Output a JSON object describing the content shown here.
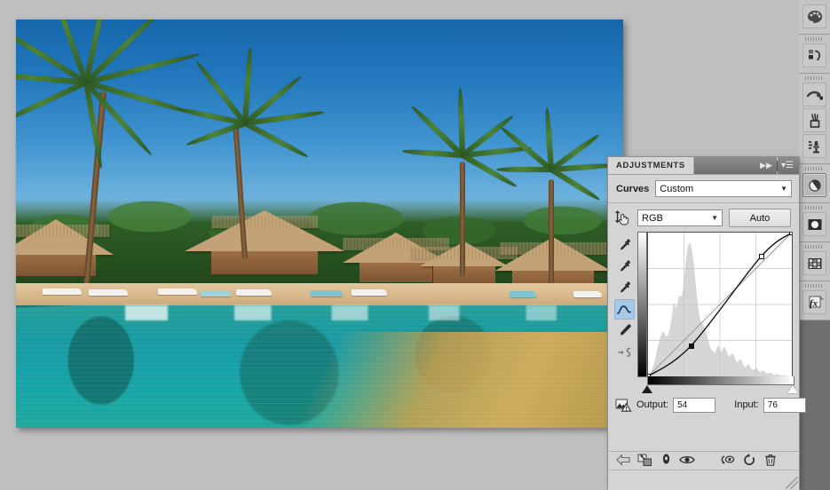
{
  "app": {
    "background_color": "#bfbfbf",
    "dock_background": "#6f6f6f"
  },
  "document": {
    "title": "tropical-resort-pool",
    "scene_description": "Tropical resort with palm trees, thatched palapa huts and a turquoise swimming pool with reflections",
    "sky_color": "#2277bd",
    "water_color": "#19a0a6",
    "sand_color": "#d6a046"
  },
  "panel": {
    "tab_label": "ADJUSTMENTS",
    "collapse_icon": "double-chevron-right-icon",
    "menu_icon": "panel-menu-icon",
    "preset": {
      "label": "Curves",
      "value": "Custom",
      "caret": "chevron-down-icon"
    },
    "channel": {
      "target_tool_icon": "on-image-adjust-icon",
      "value": "RGB",
      "caret": "chevron-down-icon",
      "auto_label": "Auto"
    },
    "curve_tools": [
      {
        "name": "black-point-eyedropper",
        "icon": "eyedropper-icon",
        "active": false
      },
      {
        "name": "gray-point-eyedropper",
        "icon": "eyedropper-icon",
        "active": false
      },
      {
        "name": "white-point-eyedropper",
        "icon": "eyedropper-icon",
        "active": false
      },
      {
        "name": "edit-points-tool",
        "icon": "curve-icon",
        "active": true
      },
      {
        "name": "pencil-draw-tool",
        "icon": "pencil-icon",
        "active": false
      },
      {
        "name": "smooth-curve-tool",
        "icon": "smooth-icon",
        "active": false
      }
    ],
    "io": {
      "clip_warning_icon": "clipping-warning-icon",
      "output_label": "Output:",
      "output_value": "54",
      "input_label": "Input:",
      "input_value": "76"
    },
    "footer_buttons": [
      {
        "name": "return-to-adjustment-list-button",
        "icon": "left-arrow-icon"
      },
      {
        "name": "clip-to-layer-button",
        "icon": "clip-to-layer-icon"
      },
      {
        "name": "toggle-layer-visibility-button",
        "icon": "eye-mask-icon"
      },
      {
        "name": "preview-button",
        "icon": "eye-icon"
      },
      {
        "name": "reset-previous-state-button",
        "icon": "undo-state-icon"
      },
      {
        "name": "reset-adjustment-button",
        "icon": "reset-icon"
      },
      {
        "name": "delete-adjustment-layer-button",
        "icon": "trash-icon"
      }
    ]
  },
  "chart_data": {
    "type": "line",
    "title": "Curves",
    "xlabel": "Input",
    "ylabel": "Output",
    "xlim": [
      0,
      255
    ],
    "ylim": [
      0,
      255
    ],
    "grid": true,
    "grid_divisions": 4,
    "channel": "RGB",
    "series": [
      {
        "name": "Baseline (identity)",
        "points": [
          [
            0,
            0
          ],
          [
            255,
            255
          ]
        ],
        "style": "straight-gray-reference-line"
      },
      {
        "name": "Curve",
        "points": [
          [
            0,
            0
          ],
          [
            76,
            54
          ],
          [
            200,
            212
          ],
          [
            255,
            255
          ]
        ],
        "style": "black-spline"
      }
    ],
    "control_points": [
      {
        "input": 0,
        "output": 0,
        "selected": false
      },
      {
        "input": 76,
        "output": 54,
        "selected": true
      },
      {
        "input": 200,
        "output": 212,
        "selected": false
      },
      {
        "input": 255,
        "output": 255,
        "selected": false
      }
    ],
    "histogram": {
      "description": "Luminance histogram shown as light-gray fill behind curve",
      "bins": [
        2,
        3,
        4,
        4,
        5,
        6,
        8,
        10,
        12,
        14,
        16,
        19,
        22,
        26,
        30,
        34,
        38,
        42,
        45,
        47,
        50,
        53,
        56,
        58,
        60,
        62,
        63,
        63,
        62,
        60,
        58,
        57,
        56,
        56,
        57,
        58,
        60,
        63,
        66,
        70,
        75,
        80,
        86,
        92,
        97,
        101,
        103,
        101,
        98,
        96,
        97,
        100,
        104,
        108,
        111,
        113,
        114,
        113,
        112,
        113,
        116,
        120,
        126,
        133,
        141,
        150,
        159,
        166,
        172,
        177,
        181,
        184,
        186,
        187,
        186,
        184,
        180,
        176,
        171,
        165,
        158,
        150,
        142,
        134,
        126,
        118,
        110,
        103,
        96,
        90,
        85,
        81,
        78,
        76,
        75,
        74,
        73,
        72,
        70,
        68,
        66,
        64,
        61,
        58,
        55,
        52,
        49,
        46,
        43,
        41,
        39,
        38,
        37,
        36,
        35,
        34,
        33,
        33,
        34,
        36,
        38,
        40,
        42,
        43,
        42,
        40,
        38,
        36,
        35,
        35,
        36,
        38,
        40,
        41,
        41,
        40,
        38,
        36,
        34,
        32,
        30,
        29,
        28,
        28,
        29,
        30,
        31,
        32,
        32,
        31,
        30,
        28,
        26,
        24,
        22,
        21,
        20,
        20,
        21,
        22,
        23,
        24,
        24,
        23,
        22,
        20,
        18,
        16,
        15,
        14,
        13,
        13,
        14,
        15,
        16,
        17,
        17,
        16,
        15,
        14,
        12,
        11,
        10,
        9,
        9,
        9,
        10,
        11,
        12,
        12,
        12,
        11,
        10,
        9,
        8,
        7,
        6,
        6,
        6,
        7,
        8,
        8,
        8,
        8,
        7,
        6,
        5,
        5,
        4,
        4,
        4,
        4,
        5,
        5,
        5,
        5,
        4,
        4,
        3,
        3,
        3,
        2,
        2,
        2,
        2,
        3,
        3,
        3,
        3,
        2,
        2,
        2,
        1,
        1,
        1,
        1,
        1,
        1,
        1,
        1,
        1,
        1,
        1,
        1,
        0,
        0,
        0,
        0,
        0,
        0,
        0,
        0,
        0
      ]
    },
    "sliders": {
      "black_point": 0,
      "white_point": 255
    }
  },
  "right_dock": {
    "groups": [
      {
        "items": [
          {
            "name": "color-panel-icon",
            "icon": "color-palette-icon",
            "active": false
          }
        ]
      },
      {
        "items": [
          {
            "name": "history-panel-icon",
            "icon": "history-icon",
            "active": false
          }
        ]
      },
      {
        "items": [
          {
            "name": "brush-panel-icon",
            "icon": "brush-stroke-icon",
            "active": false
          },
          {
            "name": "brush-presets-icon",
            "icon": "brush-jar-icon",
            "active": false
          },
          {
            "name": "clone-source-icon",
            "icon": "clone-stamp-icon",
            "active": false
          }
        ]
      },
      {
        "items": [
          {
            "name": "adjustments-panel-icon",
            "icon": "adjustments-circle-icon",
            "active": true
          }
        ]
      },
      {
        "items": [
          {
            "name": "masks-panel-icon",
            "icon": "mask-circle-icon",
            "active": false
          }
        ]
      },
      {
        "items": [
          {
            "name": "layer-comps-panel-icon",
            "icon": "grid-squares-icon",
            "active": false
          }
        ]
      },
      {
        "items": [
          {
            "name": "styles-panel-icon",
            "icon": "fx-icon",
            "active": false
          }
        ]
      }
    ]
  }
}
